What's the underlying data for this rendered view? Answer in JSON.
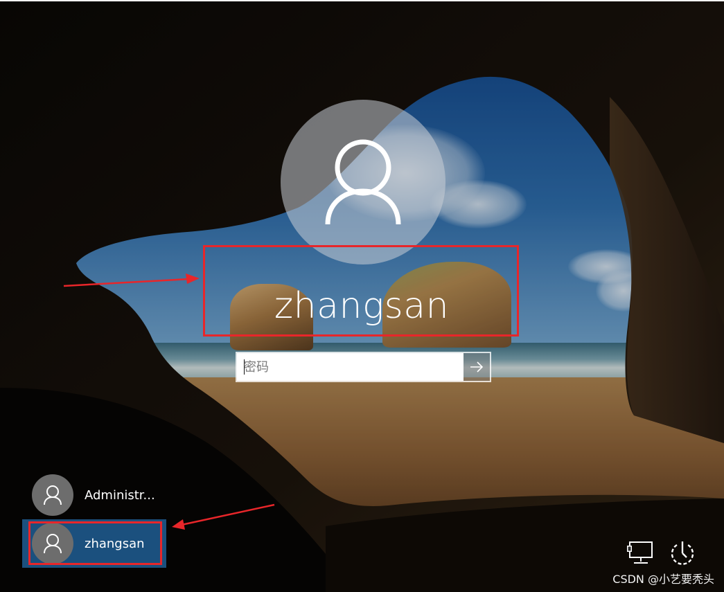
{
  "login": {
    "username": "zhangsan",
    "password_placeholder": "密码"
  },
  "user_list": [
    {
      "label": "Administr..."
    },
    {
      "label": "zhangsan",
      "selected": true
    }
  ],
  "icons": {
    "avatar": "user-icon",
    "submit": "arrow-right-icon",
    "network": "network-icon",
    "power": "power-icon"
  },
  "colors": {
    "highlight": "#e8262a",
    "selected_user_bg": "#1b507e"
  },
  "watermark": "CSDN @小艺要秃头"
}
